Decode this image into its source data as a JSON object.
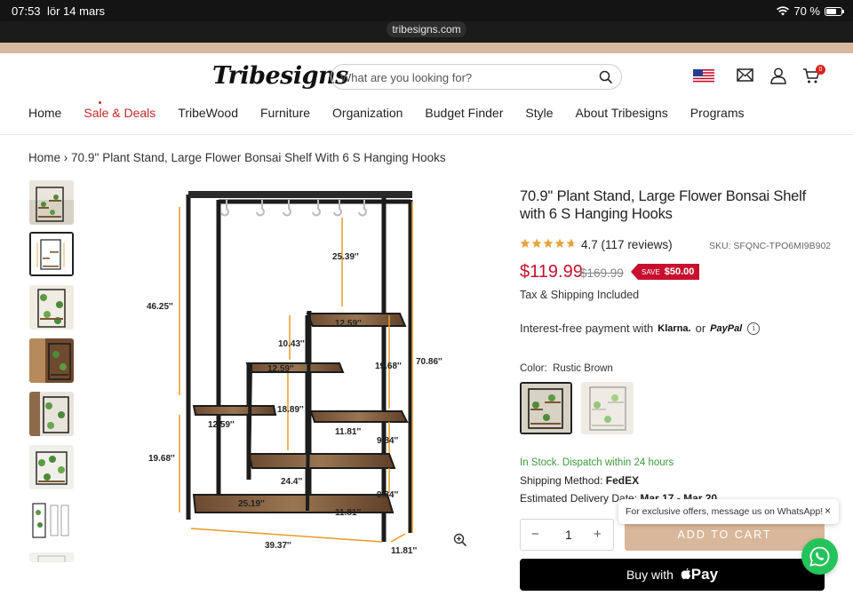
{
  "status_bar": {
    "time": "07:53",
    "date": "lör 14 mars",
    "battery": "70 %"
  },
  "browser": {
    "url": "tribesigns.com"
  },
  "header": {
    "logo": "Tribesigns",
    "search_placeholder": "What are you looking for?",
    "cart_count": "0"
  },
  "nav": [
    {
      "label": "Home"
    },
    {
      "label": "Sale & Deals"
    },
    {
      "label": "TribeWood"
    },
    {
      "label": "Furniture"
    },
    {
      "label": "Organization"
    },
    {
      "label": "Budget Finder"
    },
    {
      "label": "Style"
    },
    {
      "label": "About Tribesigns"
    },
    {
      "label": "Programs"
    }
  ],
  "breadcrumb": {
    "home": "Home",
    "separator": "›",
    "current": "70.9'' Plant Stand, Large Flower Bonsai Shelf With 6 S Hanging Hooks"
  },
  "image_labels": {
    "d1": "25.39''",
    "d2": "46.25''",
    "d3": "12.59''",
    "d4": "10.43''",
    "d5": "12.59''",
    "d6": "19.68''",
    "d7": "70.86''",
    "d8": "18.89''",
    "d9": "12.59''",
    "d10": "11.81''",
    "d11": "9.84''",
    "d12": "19.68''",
    "d13": "24.4''",
    "d14": "9.84''",
    "d15": "25.19''",
    "d16": "11.81''",
    "d17": "39.37''",
    "d18": "11.81''"
  },
  "product": {
    "title": "70.9'' Plant Stand, Large Flower Bonsai Shelf with 6 S Hanging Hooks",
    "rating": "4.7",
    "reviews": "(117 reviews)",
    "rating_value": 4.7,
    "sku": "SKU: SFQNC-TPO6MI9B902",
    "price": "$119.99",
    "old_price": "$169.99",
    "save_label": "SAVE",
    "save_amount": "$50.00",
    "tax_note": "Tax & Shipping Included",
    "payment_prefix": "Interest-free payment with",
    "klarna": "Klarna.",
    "or": "or",
    "paypal": "PayPal",
    "color_label": "Color:",
    "color_value": "Rustic Brown",
    "stock": "In Stock. Dispatch within 24 hours",
    "shipping_label": "Shipping Method:",
    "shipping_value": "FedEX",
    "delivery_label": "Estimated Delivery Date:",
    "delivery_value": "Mar 17 - Mar 20",
    "quantity": "1",
    "add_to_cart": "ADD TO CART",
    "buy_with": "Buy with",
    "apple_pay": "Pay"
  },
  "whatsapp": {
    "tooltip": "For exclusive offers, message us on WhatsApp!",
    "close": "×"
  },
  "colors": {
    "accent_red": "#c8102e",
    "add_to_cart_bg": "#d9b79a",
    "stock_green": "#3a9a3a",
    "whatsapp": "#25c35b"
  }
}
